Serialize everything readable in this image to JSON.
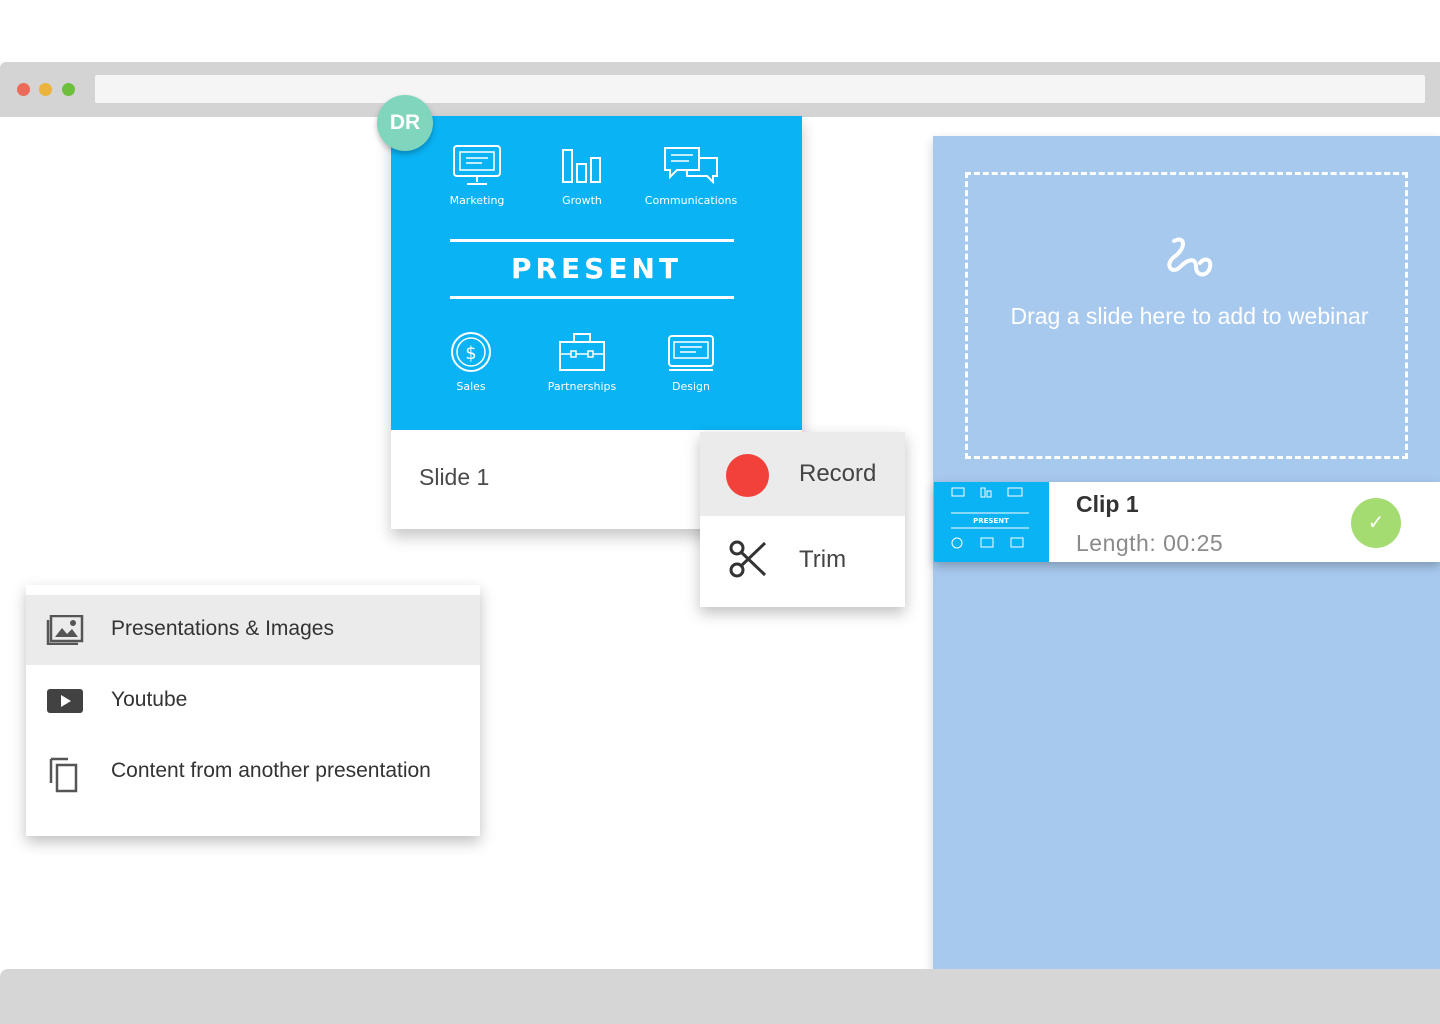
{
  "slide": {
    "avatar_initials": "DR",
    "top_items": [
      "Marketing",
      "Growth",
      "Communications"
    ],
    "title": "PRESENT",
    "bottom_items": [
      "Sales",
      "Partnerships",
      "Design"
    ],
    "label": "Slide 1",
    "background_color": "#0ab3f4"
  },
  "action_menu": {
    "record_label": "Record",
    "trim_label": "Trim",
    "record_color": "#f2403a"
  },
  "source_menu": {
    "items": [
      {
        "label": "Presentations & Images",
        "icon": "images-icon"
      },
      {
        "label": "Youtube",
        "icon": "youtube-icon"
      },
      {
        "label": "Content from another presentation",
        "icon": "copy-icon"
      }
    ]
  },
  "webinar": {
    "drop_text": "Drag a slide here to add to webinar",
    "panel_color": "#a8c9ee",
    "clip": {
      "title": "Clip 1",
      "length": "Length: 00:25",
      "status": "check-icon"
    }
  }
}
